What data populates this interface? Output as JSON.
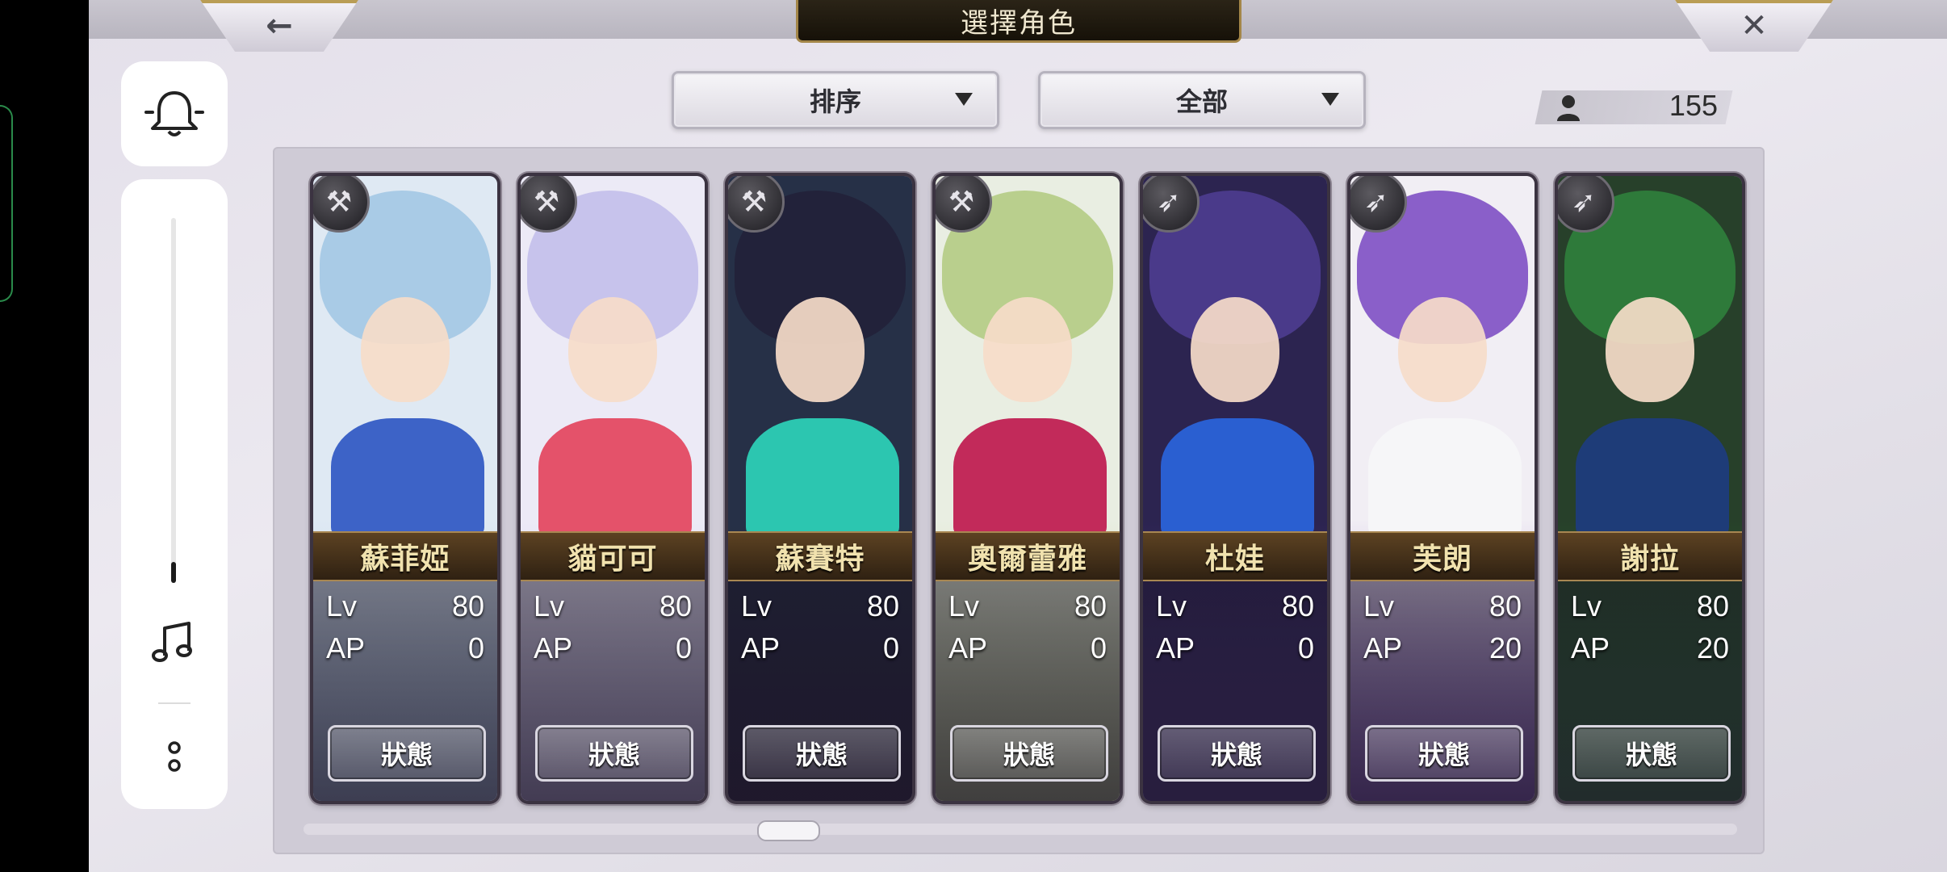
{
  "screen": {
    "title": "選擇角色",
    "back_icon": "←",
    "close_icon": "✕"
  },
  "filters": {
    "sort_label": "排序",
    "filter_label": "全部",
    "character_count": "155"
  },
  "side_panel": {
    "icons": [
      "bell-icon",
      "volume-slider",
      "music-note-icon",
      "more-icon"
    ],
    "volume_level": 0.05
  },
  "characters": [
    {
      "name": "蘇菲婭",
      "lv_label": "Lv",
      "lv": "80",
      "ap_label": "AP",
      "ap": "0",
      "weapon": "axe-icon",
      "status_label": "狀態",
      "palette": [
        "#dfe9f3",
        "#a9cbe6",
        "#3d63c7"
      ]
    },
    {
      "name": "貓可可",
      "lv_label": "Lv",
      "lv": "80",
      "ap_label": "AP",
      "ap": "0",
      "weapon": "axe-icon",
      "status_label": "狀態",
      "palette": [
        "#eceaf6",
        "#c7c3ec",
        "#e4526a"
      ]
    },
    {
      "name": "蘇賽特",
      "lv_label": "Lv",
      "lv": "80",
      "ap_label": "AP",
      "ap": "0",
      "weapon": "axe-icon",
      "status_label": "狀態",
      "palette": [
        "#263047",
        "#22223a",
        "#2cc6b0"
      ]
    },
    {
      "name": "奧爾蕾雅",
      "lv_label": "Lv",
      "lv": "80",
      "ap_label": "AP",
      "ap": "0",
      "weapon": "axe-icon",
      "status_label": "狀態",
      "palette": [
        "#e9eee2",
        "#b9cf8d",
        "#c22a5a"
      ]
    },
    {
      "name": "杜娃",
      "lv_label": "Lv",
      "lv": "80",
      "ap_label": "AP",
      "ap": "0",
      "weapon": "spear-icon",
      "status_label": "狀態",
      "palette": [
        "#2c2450",
        "#4a3a8a",
        "#2a5fd1"
      ]
    },
    {
      "name": "芙朗",
      "lv_label": "Lv",
      "lv": "80",
      "ap_label": "AP",
      "ap": "20",
      "weapon": "spear-icon",
      "status_label": "狀態",
      "palette": [
        "#f1eef4",
        "#8a5fc9",
        "#f6f6f8"
      ]
    },
    {
      "name": "謝拉",
      "lv_label": "Lv",
      "lv": "80",
      "ap_label": "AP",
      "ap": "20",
      "weapon": "spear-icon",
      "status_label": "狀態",
      "palette": [
        "#27402a",
        "#2e7a3a",
        "#1e3c78"
      ]
    }
  ]
}
